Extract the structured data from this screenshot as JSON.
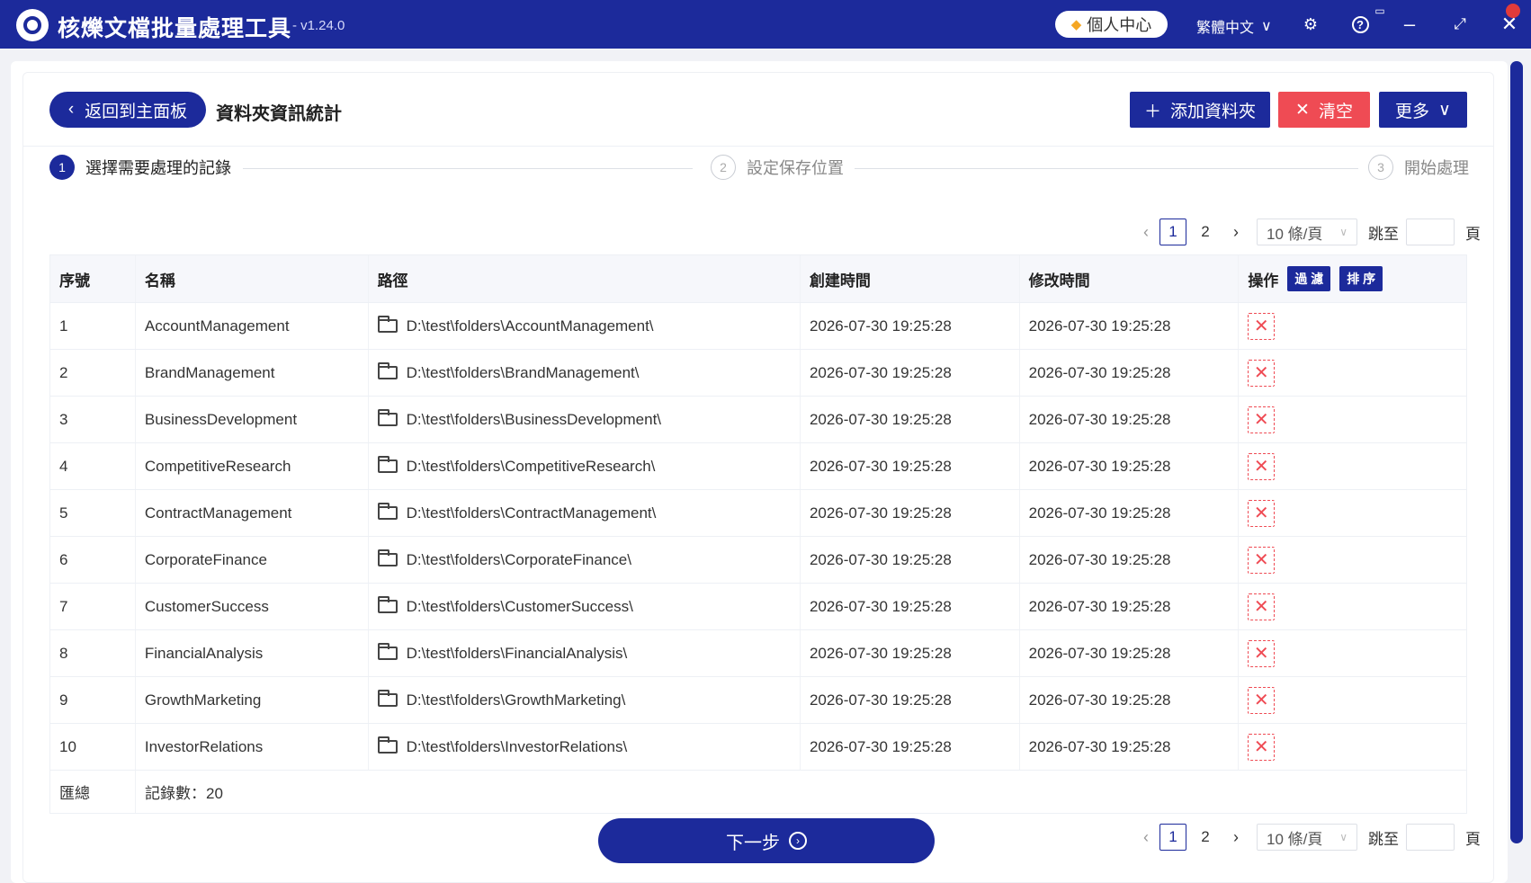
{
  "app": {
    "title": "核爍文檔批量處理工具",
    "version": "- v1.24.0",
    "user_center": "個人中心",
    "language": "繁體中文"
  },
  "header": {
    "back_label": "返回到主面板",
    "page_title": "資料夾資訊統計",
    "add_label": "添加資料夾",
    "clear_label": "清空",
    "more_label": "更多"
  },
  "steps": [
    {
      "num": "1",
      "label": "選擇需要處理的記錄",
      "active": true
    },
    {
      "num": "2",
      "label": "設定保存位置",
      "active": false
    },
    {
      "num": "3",
      "label": "開始處理",
      "active": false
    }
  ],
  "pagination": {
    "current": "1",
    "next_page": "2",
    "page_size": "10 條/頁",
    "jump_label": "跳至",
    "page_unit": "頁"
  },
  "table": {
    "headers": [
      "序號",
      "名稱",
      "路徑",
      "創建時間",
      "修改時間",
      "操作"
    ],
    "filter_label": "過 濾",
    "sort_label": "排 序",
    "rows": [
      {
        "idx": "1",
        "name": "AccountManagement",
        "path": "D:\\test\\folders\\AccountManagement\\",
        "created": "2026-07-30 19:25:28",
        "modified": "2026-07-30 19:25:28"
      },
      {
        "idx": "2",
        "name": "BrandManagement",
        "path": "D:\\test\\folders\\BrandManagement\\",
        "created": "2026-07-30 19:25:28",
        "modified": "2026-07-30 19:25:28"
      },
      {
        "idx": "3",
        "name": "BusinessDevelopment",
        "path": "D:\\test\\folders\\BusinessDevelopment\\",
        "created": "2026-07-30 19:25:28",
        "modified": "2026-07-30 19:25:28"
      },
      {
        "idx": "4",
        "name": "CompetitiveResearch",
        "path": "D:\\test\\folders\\CompetitiveResearch\\",
        "created": "2026-07-30 19:25:28",
        "modified": "2026-07-30 19:25:28"
      },
      {
        "idx": "5",
        "name": "ContractManagement",
        "path": "D:\\test\\folders\\ContractManagement\\",
        "created": "2026-07-30 19:25:28",
        "modified": "2026-07-30 19:25:28"
      },
      {
        "idx": "6",
        "name": "CorporateFinance",
        "path": "D:\\test\\folders\\CorporateFinance\\",
        "created": "2026-07-30 19:25:28",
        "modified": "2026-07-30 19:25:28"
      },
      {
        "idx": "7",
        "name": "CustomerSuccess",
        "path": "D:\\test\\folders\\CustomerSuccess\\",
        "created": "2026-07-30 19:25:28",
        "modified": "2026-07-30 19:25:28"
      },
      {
        "idx": "8",
        "name": "FinancialAnalysis",
        "path": "D:\\test\\folders\\FinancialAnalysis\\",
        "created": "2026-07-30 19:25:28",
        "modified": "2026-07-30 19:25:28"
      },
      {
        "idx": "9",
        "name": "GrowthMarketing",
        "path": "D:\\test\\folders\\GrowthMarketing\\",
        "created": "2026-07-30 19:25:28",
        "modified": "2026-07-30 19:25:28"
      },
      {
        "idx": "10",
        "name": "InvestorRelations",
        "path": "D:\\test\\folders\\InvestorRelations\\",
        "created": "2026-07-30 19:25:28",
        "modified": "2026-07-30 19:25:28"
      }
    ],
    "summary_label": "匯總",
    "summary_value": "記錄數：20"
  },
  "footer": {
    "next_label": "下一步"
  },
  "colors": {
    "primary": "#1c2a9b",
    "danger": "#ef4b54"
  }
}
